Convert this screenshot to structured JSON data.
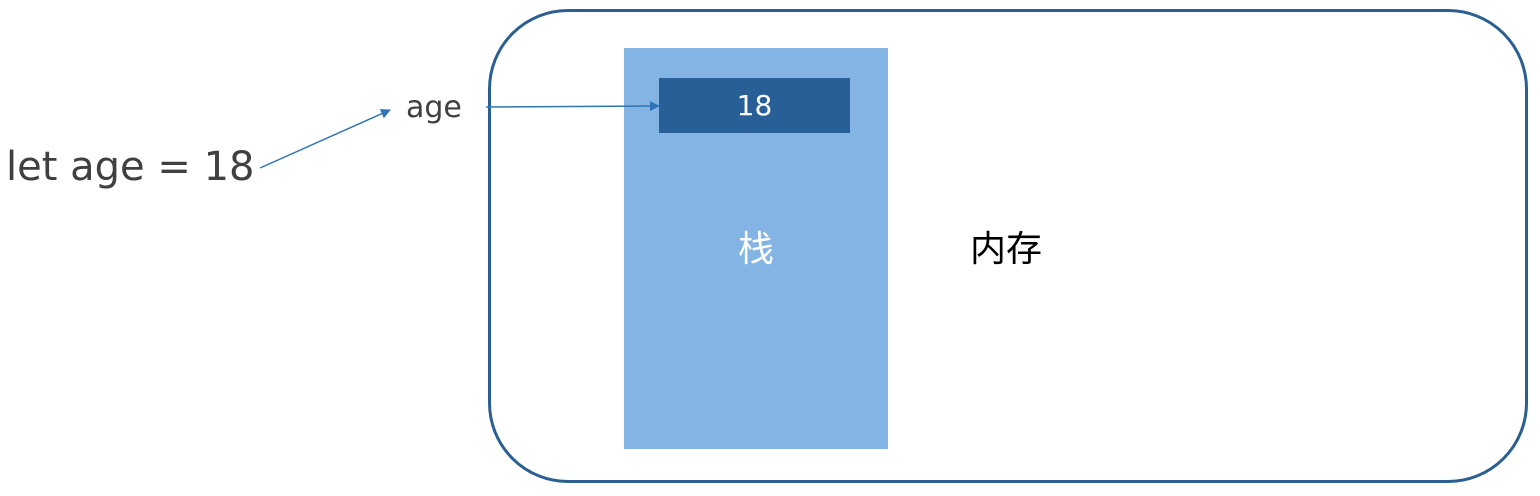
{
  "code_statement": "let age = 18",
  "variable_name": "age",
  "stored_value": "18",
  "stack_label": "栈",
  "memory_label": "内存",
  "colors": {
    "memory_border": "#2b5f92",
    "stack_fill": "#84b4e4",
    "value_cell_fill": "#285f96",
    "arrow": "#2e75b6",
    "text_dark": "#404040"
  }
}
